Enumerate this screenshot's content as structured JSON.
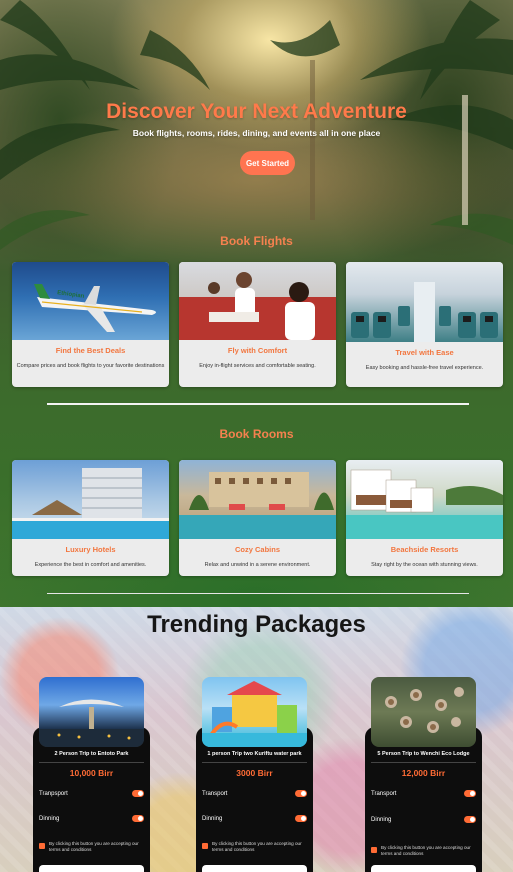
{
  "hero": {
    "title": "Discover Your Next Adventure",
    "subtitle": "Book flights, rooms, rides, dining, and events all in one place",
    "cta_label": "Get Started"
  },
  "flights": {
    "title": "Book Flights",
    "cards": [
      {
        "title": "Find the Best Deals",
        "description": "Compare prices and book flights to your favorite destinations",
        "image_text": "Ethiopian"
      },
      {
        "title": "Fly with Comfort",
        "description": "Enjoy in-flight services and comfortable seating."
      },
      {
        "title": "Travel with Ease",
        "description": "Easy booking and hassle-free travel experience."
      }
    ]
  },
  "rooms": {
    "title": "Book Rooms",
    "cards": [
      {
        "title": "Luxury Hotels",
        "description": "Experience the best in comfort and amenities."
      },
      {
        "title": "Cozy Cabins",
        "description": "Relax and unwind in a serene environment."
      },
      {
        "title": "Beachside Resorts",
        "description": "Stay right by the ocean with stunning views."
      }
    ]
  },
  "packages": {
    "title": "Trending Packages",
    "items": [
      {
        "name": "2 Person Trip to Entoto Park",
        "price": "10,000 Birr",
        "opt1": "Tranpsport",
        "opt2": "Dinning",
        "terms": "By clicking this button you are accepting our terms and conditions"
      },
      {
        "name": "1 person Trip two Kuriftu water park",
        "price": "3000 Birr",
        "opt1": "Transport",
        "opt2": "Dinning",
        "terms": "By clicking this button you are accepting our terms and conditions"
      },
      {
        "name": "5 Person Trip to Wenchi Eco Lodge",
        "price": "12,000 Birr",
        "opt1": "Transport",
        "opt2": "Dinning",
        "terms": "By clicking this button you are accepting our terms and conditions"
      }
    ]
  },
  "colors": {
    "accent": "#ff7450",
    "price": "#ff6b35",
    "card": "#ececec"
  }
}
